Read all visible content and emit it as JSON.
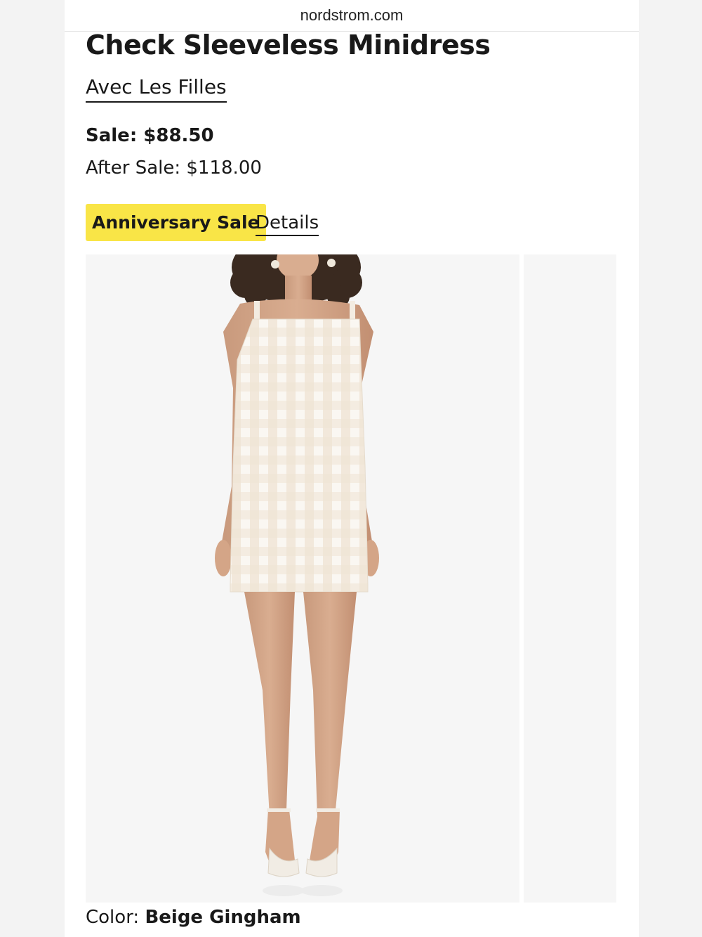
{
  "browser": {
    "url": "nordstrom.com"
  },
  "product": {
    "title": "Check Sleeveless Minidress",
    "brand": "Avec Les Filles",
    "sale_price": "Sale: $88.50",
    "after_sale_price": "After Sale: $118.00",
    "badge": "Anniversary Sale",
    "details_link": "Details",
    "color_label": "Color: ",
    "color_value": "Beige Gingham"
  },
  "image": {
    "subject": "model wearing beige gingham sleeveless minidress",
    "background_color": "#f6f6f6",
    "dress_colors": [
      "#efe3d3",
      "#faf7f2"
    ]
  },
  "colors": {
    "badge_yellow": "#f9e547",
    "text": "#191919"
  }
}
